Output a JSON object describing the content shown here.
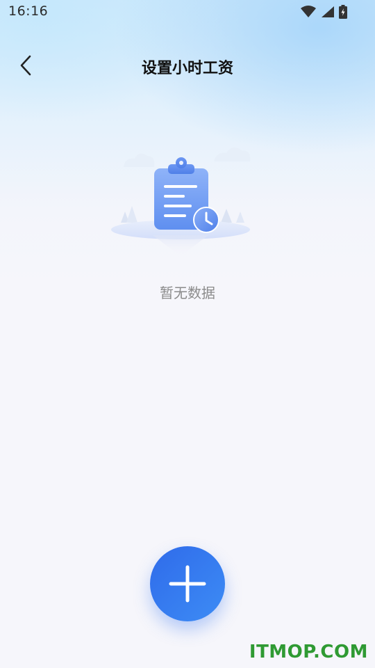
{
  "status_bar": {
    "time": "16:16",
    "icons": [
      "wifi-icon",
      "signal-icon",
      "battery-charging-icon"
    ]
  },
  "nav": {
    "back_icon": "chevron-left-icon",
    "title": "设置小时工资"
  },
  "empty_state": {
    "illustration": "clipboard-clock-illustration",
    "message": "暂无数据"
  },
  "fab": {
    "icon": "plus-icon",
    "color_start": "#2f6bea",
    "color_end": "#3d8cf5"
  },
  "watermark": {
    "text": "ITMOP.COM",
    "color": "#2f9a33"
  }
}
